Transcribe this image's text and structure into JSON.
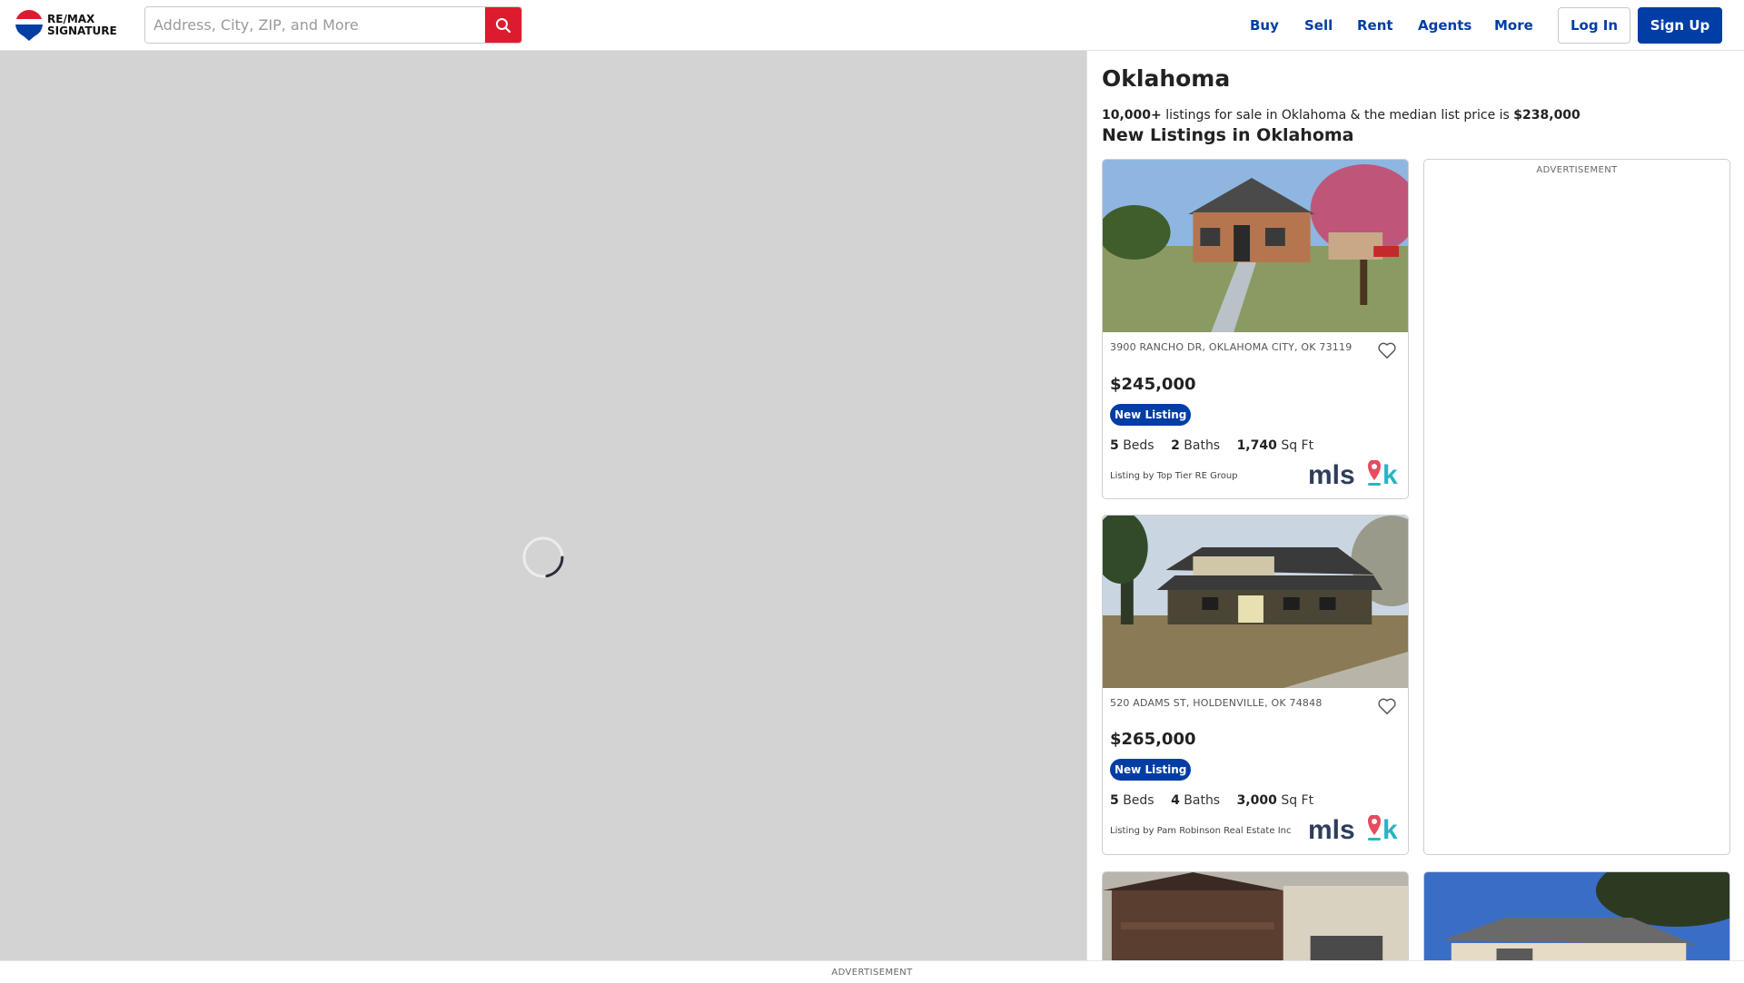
{
  "header": {
    "logo_line1": "RE/MAX",
    "logo_line2": "SIGNATURE",
    "search_placeholder": "Address, City, ZIP, and More",
    "nav": [
      "Buy",
      "Sell",
      "Rent",
      "Agents",
      "More"
    ],
    "login_label": "Log In",
    "signup_label": "Sign Up"
  },
  "panel": {
    "title": "Oklahoma",
    "summary_count": "10,000+",
    "summary_middle": " listings for sale in Oklahoma & the median list price is ",
    "summary_price": "$238,000",
    "section_title": "New Listings in Oklahoma",
    "ad_label": "ADVERTISEMENT"
  },
  "listings": [
    {
      "address": "3900 RANCHO DR, OKLAHOMA CITY, OK 73119",
      "price": "$245,000",
      "badge": "New Listing",
      "beds": "5",
      "beds_label": "Beds",
      "baths": "2",
      "baths_label": "Baths",
      "sqft": "1,740",
      "sqft_label": "Sq Ft",
      "brokerage": "Listing by Top Tier RE Group",
      "mls": "mlsok"
    },
    {
      "address": "520 ADAMS ST, HOLDENVILLE, OK 74848",
      "price": "$265,000",
      "badge": "New Listing",
      "beds": "5",
      "beds_label": "Beds",
      "baths": "4",
      "baths_label": "Baths",
      "sqft": "3,000",
      "sqft_label": "Sq Ft",
      "brokerage": "Listing by Pam Robinson Real Estate Inc",
      "mls": "mlsok"
    }
  ],
  "bottom_ad_label": "ADVERTISEMENT",
  "colors": {
    "brand_blue": "#003da5",
    "brand_red": "#dc1c2e",
    "map_gray": "#d3d3d3"
  }
}
